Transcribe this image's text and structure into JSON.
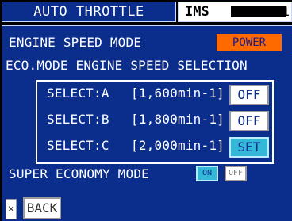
{
  "header": {
    "title": "AUTO THROTTLE",
    "system_label": "IMS",
    "system_id_suffix": "1"
  },
  "engine_speed_mode": {
    "label": "ENGINE SPEED MODE",
    "value": "POWER"
  },
  "eco_mode": {
    "heading": "ECO.MODE ENGINE SPEED SELECTION",
    "options": [
      {
        "name": "SELECT:A",
        "speed": "[1,600min-1]",
        "state": "OFF"
      },
      {
        "name": "SELECT:B",
        "speed": "[1,800min-1]",
        "state": "OFF"
      },
      {
        "name": "SELECT:C",
        "speed": "[2,000min-1]",
        "state": "SET"
      }
    ]
  },
  "super_economy": {
    "label": "SUPER ECONOMY MODE",
    "on_label": "ON",
    "off_label": "OFF",
    "active": "ON"
  },
  "footer": {
    "close_label": "×",
    "back_label": "BACK"
  },
  "colors": {
    "background_blue": "#0b2d8c",
    "power_orange": "#ff6a00",
    "active_cyan": "#33b8d8"
  }
}
